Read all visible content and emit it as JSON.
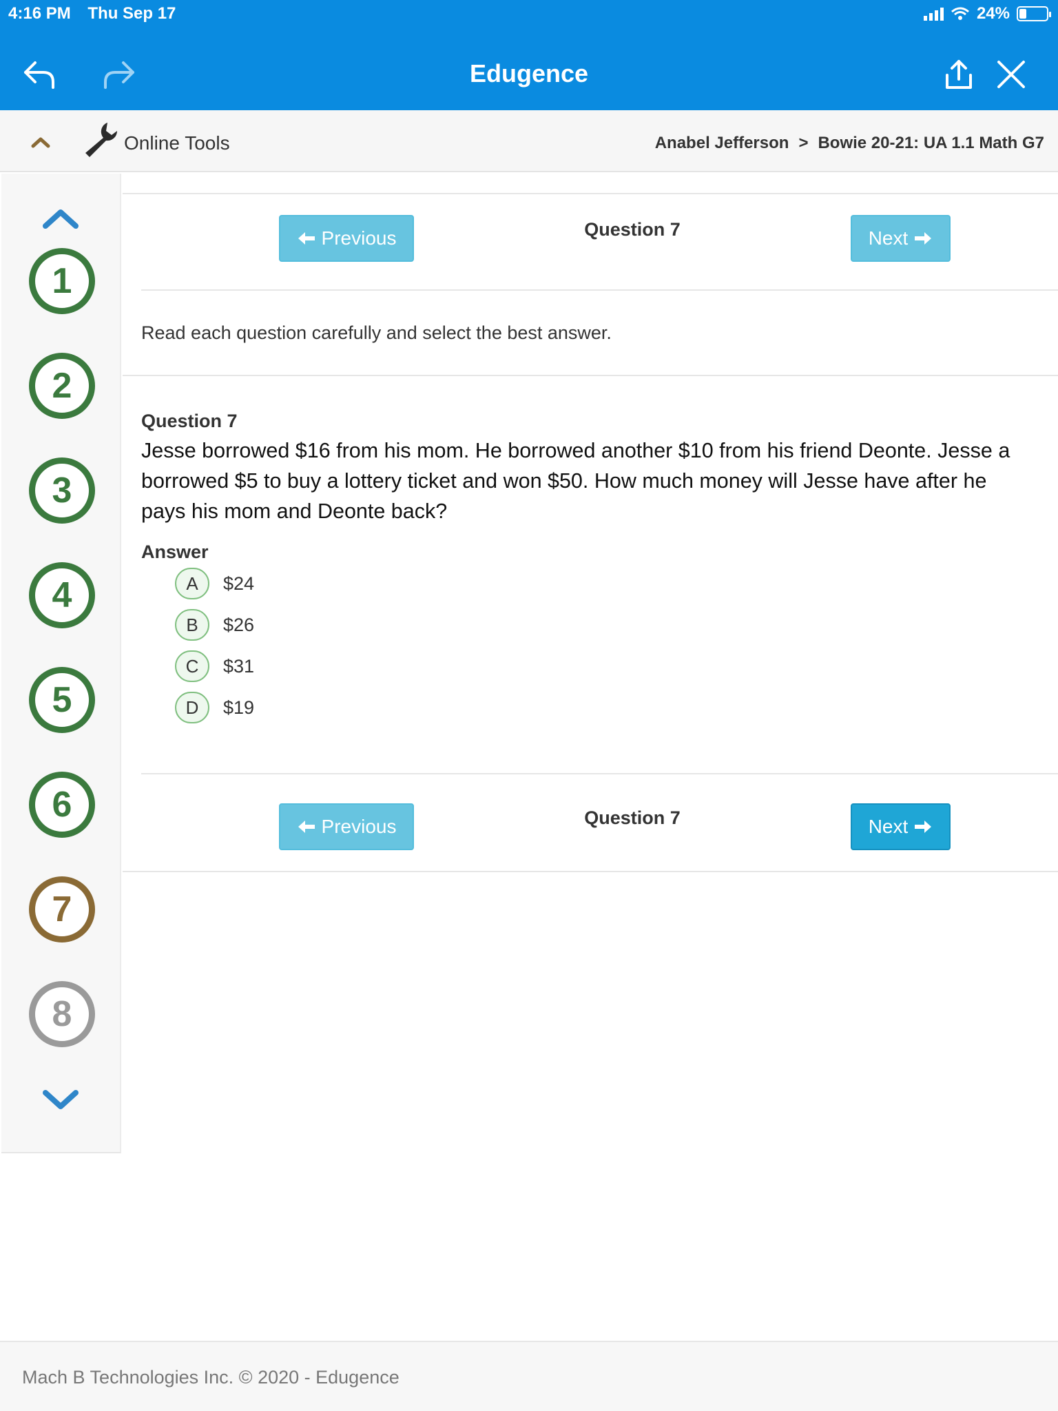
{
  "status_bar": {
    "time": "4:16 PM",
    "date": "Thu Sep 17",
    "battery": "24%"
  },
  "app": {
    "title": "Edugence"
  },
  "toolbar": {
    "online_tools": "Online Tools",
    "breadcrumb": [
      "Anabel Jefferson",
      ">",
      "Bowie 20-21: UA 1.1 Math G7"
    ]
  },
  "sidebar": {
    "questions": [
      "1",
      "2",
      "3",
      "4",
      "5",
      "6",
      "7",
      "8"
    ]
  },
  "nav": {
    "previous_label": "Previous",
    "next_label": "Next",
    "question_label": "Question 7"
  },
  "content": {
    "instructions": "Read each question carefully and select the best answer.",
    "question_title": "Question 7",
    "question_lines": [
      "Jesse borrowed $16 from his mom. He borrowed another $10 from his friend Deonte. Jesse a",
      "borrowed $5 to buy a lottery ticket and won $50. How much money will Jesse have after he",
      "pays his mom and Deonte back?"
    ],
    "answer_label": "Answer",
    "choices": [
      {
        "letter": "A",
        "text": "$24"
      },
      {
        "letter": "B",
        "text": "$26"
      },
      {
        "letter": "C",
        "text": "$31"
      },
      {
        "letter": "D",
        "text": "$19"
      }
    ]
  },
  "footer": {
    "text": "Mach B Technologies Inc. © 2020 - Edugence"
  },
  "colors": {
    "app_bar": "#0a8be0",
    "button": "#5bc0de",
    "answered": "#3b7a3e",
    "current": "#8a6a35",
    "unanswered": "#9a9a9a"
  }
}
